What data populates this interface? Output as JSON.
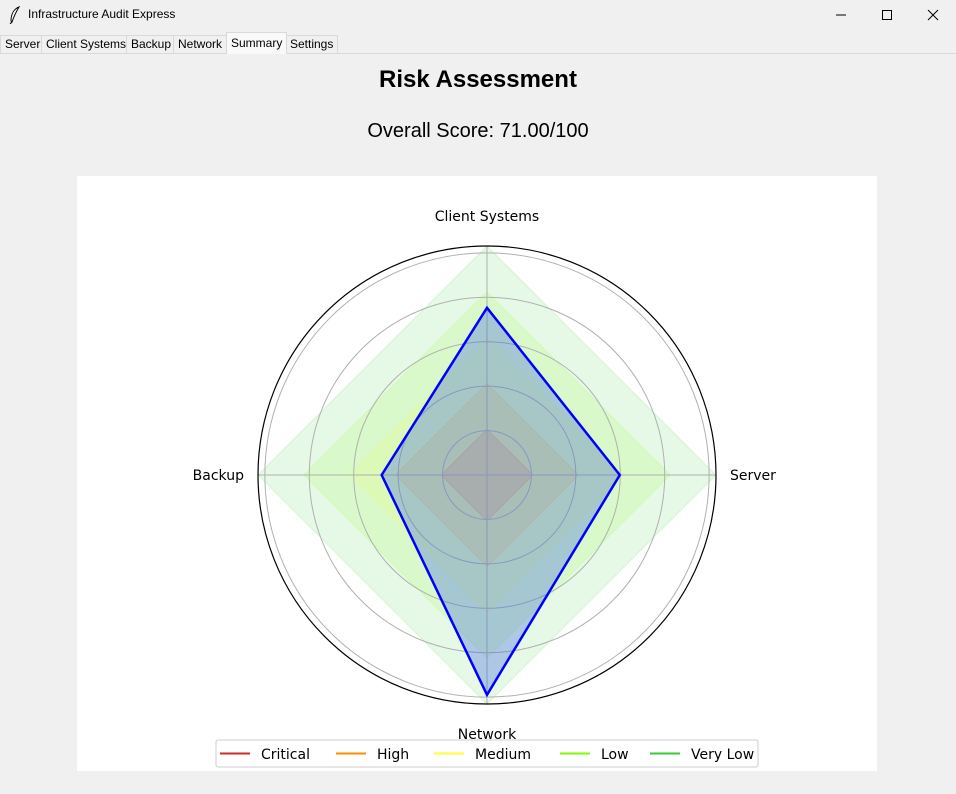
{
  "window": {
    "title": "Infrastructure Audit Express",
    "icon": "feather-icon",
    "controls": [
      "minimize-icon",
      "maximize-icon",
      "close-icon"
    ]
  },
  "tabs": [
    {
      "label": "Server",
      "active": false
    },
    {
      "label": "Client Systems",
      "active": false
    },
    {
      "label": "Backup",
      "active": false
    },
    {
      "label": "Network",
      "active": false
    },
    {
      "label": "Summary",
      "active": true
    },
    {
      "label": "Settings",
      "active": false
    }
  ],
  "summary": {
    "heading": "Risk Assessment",
    "score_text": "Overall Score: 71.00/100"
  },
  "chart_data": {
    "type": "radar",
    "categories": [
      "Server",
      "Client Systems",
      "Backup",
      "Network"
    ],
    "rmax": 100,
    "grid": true,
    "series": [
      {
        "name": "",
        "values": [
          58,
          73,
          46,
          96
        ],
        "color": "#0000ff",
        "fill": "#4169e1"
      }
    ],
    "bands": [
      {
        "name": "Critical",
        "value": 20,
        "color": "#d62728"
      },
      {
        "name": "High",
        "value": 40,
        "color": "#ff8c00"
      },
      {
        "name": "Medium",
        "value": 60,
        "color": "#ffff33"
      },
      {
        "name": "Low",
        "value": 80,
        "color": "#7cfc00"
      },
      {
        "name": "Very Low",
        "value": 100,
        "color": "#32cd32"
      }
    ],
    "legend_position": "bottom-center"
  }
}
